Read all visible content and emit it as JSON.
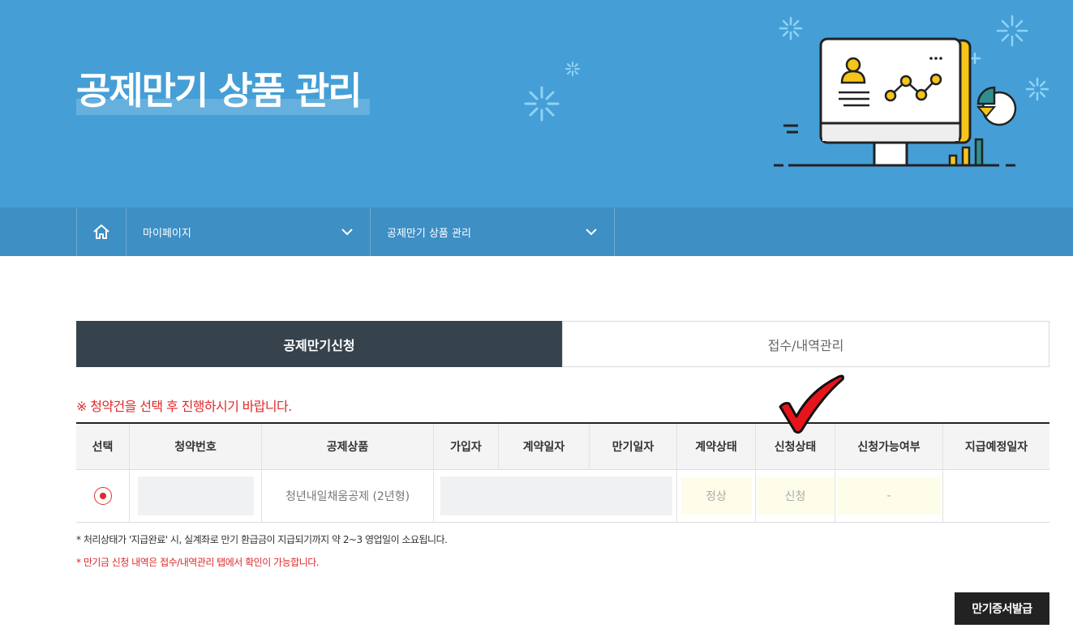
{
  "hero": {
    "title": "공제만기 상품 관리"
  },
  "locbar": {
    "home_icon": "home-icon",
    "items": [
      {
        "label": "마이페이지",
        "icon": "chevron-down-icon"
      },
      {
        "label": "공제만기 상품 관리",
        "icon": "chevron-down-icon"
      }
    ]
  },
  "tabs": [
    {
      "label": "공제만기신청",
      "active": true
    },
    {
      "label": "접수/내역관리",
      "active": false
    }
  ],
  "notice": "※ 청약건을 선택 후 진행하시기 바랍니다.",
  "table": {
    "headers": [
      "선택",
      "청약번호",
      "공제상품",
      "가입자",
      "계약일자",
      "만기일자",
      "계약상태",
      "신청상태",
      "신청가능여부",
      "지급예정일자"
    ],
    "rows": [
      {
        "selected": true,
        "contract_no": "",
        "product": "청년내일채움공제 (2년형)",
        "subscriber": "",
        "contract_date": "",
        "maturity_date": "",
        "contract_status": "정상",
        "apply_status": "신청",
        "eligible": "-",
        "payment_date": ""
      }
    ]
  },
  "notes": {
    "note1": "* 처리상태가 '지급완료' 시, 실계좌로 만기 환급금이 지급되기까지 약 2~3 영업일이 소요됩니다.",
    "note2": "* 만기금 신청 내역은 접수/내역관리 탭에서 확인이 가능합니다."
  },
  "buttons": {
    "issue": "만기증서발급"
  },
  "colors": {
    "hero_bg": "#459fd6",
    "locbar_bg": "#3d8fc4",
    "tab_active": "#36434c",
    "accent_red": "#e0282a"
  }
}
